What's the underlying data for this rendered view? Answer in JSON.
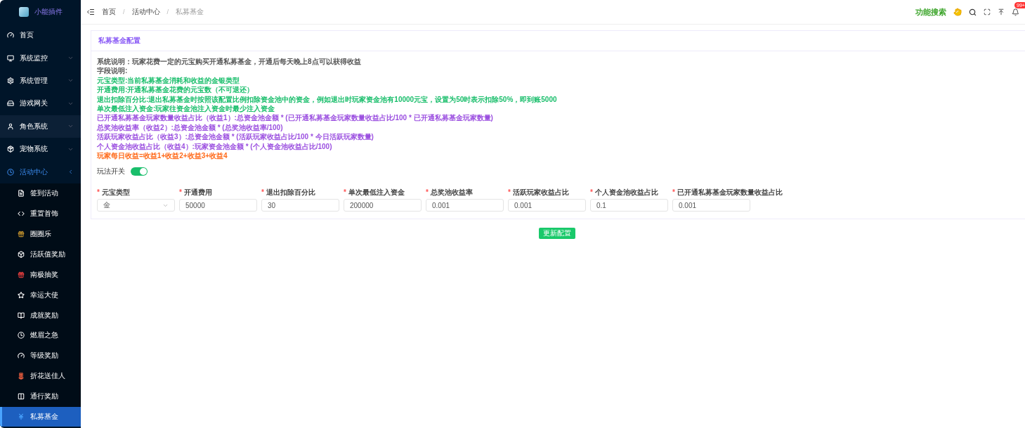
{
  "sidebar": {
    "logo_text": "小能插件",
    "items": [
      {
        "label": "首页",
        "hovered": false
      },
      {
        "label": "系统监控",
        "hovered": false,
        "expanded": false
      },
      {
        "label": "系统管理",
        "hovered": false,
        "expanded": false
      },
      {
        "label": "游戏网关",
        "hovered": false,
        "expanded": false
      },
      {
        "label": "角色系统",
        "hovered": true,
        "expanded": false
      },
      {
        "label": "宠物系统",
        "hovered": false,
        "expanded": false
      },
      {
        "label": "活动中心",
        "hovered": false,
        "expanded": true,
        "children": [
          {
            "label": "签到活动",
            "selected": false
          },
          {
            "label": "重置首饰",
            "selected": false
          },
          {
            "label": "圈圈乐",
            "selected": false
          },
          {
            "label": "活跃值奖励",
            "selected": false
          },
          {
            "label": "南极抽奖",
            "selected": false
          },
          {
            "label": "幸运大使",
            "selected": false
          },
          {
            "label": "成就奖励",
            "selected": false
          },
          {
            "label": "燃眉之急",
            "selected": false
          },
          {
            "label": "等级奖励",
            "selected": false
          },
          {
            "label": "折花送佳人",
            "selected": false
          },
          {
            "label": "通行奖励",
            "selected": false
          },
          {
            "label": "私募基金",
            "selected": true
          }
        ]
      }
    ]
  },
  "header": {
    "breadcrumbs": [
      "首页",
      "活动中心",
      "私募基金"
    ],
    "breadcrumb_separators": [
      "/",
      "/"
    ],
    "feature_search": "功能搜索",
    "notification_badge": "99+"
  },
  "card": {
    "title": "私募基金配置",
    "notes": [
      {
        "text": "系统说明：玩家花费一定的元宝购买开通私募基金，开通后每天晚上8点可以获得收益",
        "color": "#555555"
      },
      {
        "text": "字段说明:",
        "color": "#555555"
      },
      {
        "text": "元宝类型:当前私募基金消耗和收益的金银类型",
        "color": "#19be6b"
      },
      {
        "text": "开通费用:开通私募基金花费的元宝数（不可退还）",
        "color": "#19be6b"
      },
      {
        "text": "退出扣除百分比:退出私募基金时按照该配置比例扣除资金池中的资金，例如退出时玩家资金池有10000元宝，设置为50时表示扣除50%，即到账5000",
        "color": "#19be6b"
      },
      {
        "text": "单次最低注入资金:玩家往资金池注入资金时最少注入资金",
        "color": "#19be6b"
      },
      {
        "text": "已开通私募基金玩家数量收益占比（收益1）:总资金池金额 * (已开通私募基金玩家数量收益占比/100 * 已开通私募基金玩家数量)",
        "color": "#9b4fe0"
      },
      {
        "text": "总奖池收益率（收益2）:总资金池金额 * (总奖池收益率/100)",
        "color": "#9b4fe0"
      },
      {
        "text": "活跃玩家收益占比（收益3）:总资金池金额 * (活跃玩家收益占比/100 * 今日活跃玩家数量)",
        "color": "#9b4fe0"
      },
      {
        "text": "个人资金池收益占比（收益4）:玩家资金池金额 * (个人资金池收益占比/100)",
        "color": "#9b4fe0"
      },
      {
        "text": "玩家每日收益=收益1+收益2+收益3+收益4",
        "color": "#ff6a1a"
      }
    ],
    "toggle": {
      "label": "玩法开关",
      "on": true
    },
    "fields": [
      {
        "kind": "select",
        "required_mark": "*",
        "label": "元宝类型",
        "value": "金"
      },
      {
        "kind": "input",
        "required_mark": "*",
        "label": "开通费用",
        "value": "50000"
      },
      {
        "kind": "input",
        "required_mark": "*",
        "label": "退出扣除百分比",
        "value": "30"
      },
      {
        "kind": "input",
        "required_mark": "*",
        "label": "单次最低注入资金",
        "value": "200000"
      },
      {
        "kind": "input",
        "required_mark": "*",
        "label": "总奖池收益率",
        "value": "0.001"
      },
      {
        "kind": "input",
        "required_mark": "*",
        "label": "活跃玩家收益占比",
        "value": "0.001"
      },
      {
        "kind": "input",
        "required_mark": "*",
        "label": "个人资金池收益占比",
        "value": "0.1"
      },
      {
        "kind": "input",
        "required_mark": "*",
        "label": "已开通私募基金玩家数量收益占比",
        "value": "0.001"
      }
    ],
    "submit": "更新配置"
  }
}
